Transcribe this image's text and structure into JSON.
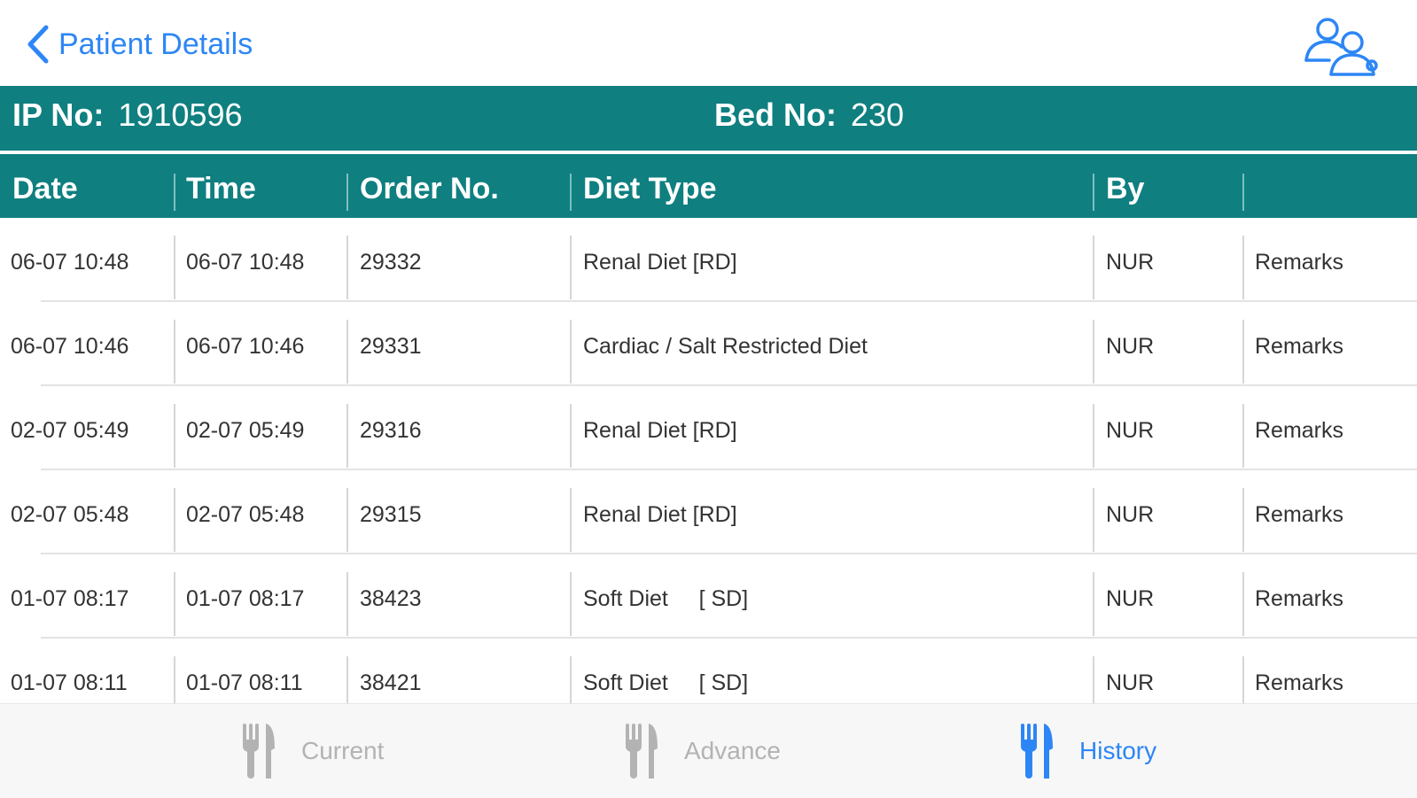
{
  "nav": {
    "back_label": "Patient Details"
  },
  "info": {
    "ip_label": "IP No:",
    "ip_value": "1910596",
    "bed_label": "Bed No:",
    "bed_value": "230"
  },
  "table": {
    "headers": [
      "Date",
      "Time",
      "Order No.",
      "Diet Type",
      "By",
      ""
    ],
    "rows": [
      {
        "date": "06-07 10:48",
        "time": "06-07 10:48",
        "order": "29332",
        "diet": "Renal Diet [RD]",
        "by": "NUR",
        "remarks": "Remarks"
      },
      {
        "date": "06-07 10:46",
        "time": "06-07 10:46",
        "order": "29331",
        "diet": "Cardiac / Salt Restricted Diet",
        "by": "NUR",
        "remarks": "Remarks"
      },
      {
        "date": "02-07 05:49",
        "time": "02-07 05:49",
        "order": "29316",
        "diet": "Renal Diet [RD]",
        "by": "NUR",
        "remarks": "Remarks"
      },
      {
        "date": "02-07 05:48",
        "time": "02-07 05:48",
        "order": "29315",
        "diet": "Renal Diet [RD]",
        "by": "NUR",
        "remarks": "Remarks"
      },
      {
        "date": "01-07 08:17",
        "time": "01-07 08:17",
        "order": "38423",
        "diet": "Soft Diet     [ SD]",
        "by": "NUR",
        "remarks": "Remarks"
      },
      {
        "date": "01-07 08:11",
        "time": "01-07 08:11",
        "order": "38421",
        "diet": "Soft Diet     [ SD]",
        "by": "NUR",
        "remarks": "Remarks"
      }
    ]
  },
  "tabs": [
    {
      "label": "Current",
      "icon": "fork-knife-icon",
      "active": false
    },
    {
      "label": "Advance",
      "icon": "fork-knife-icon",
      "active": false
    },
    {
      "label": "History",
      "icon": "fork-knife-icon",
      "active": true
    }
  ],
  "colors": {
    "accent": "#2d86f5",
    "header_bg": "#0f7f80",
    "inactive_tab": "#b3b3b3"
  }
}
